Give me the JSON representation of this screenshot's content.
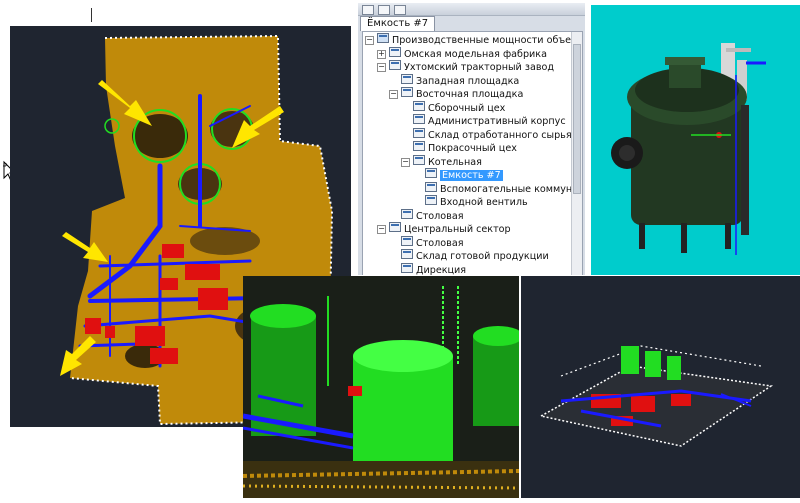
{
  "tree": {
    "tab_label": "Ёмкость #7",
    "items": [
      {
        "label": "Производственные мощности объедин",
        "depth": 0,
        "expander": "−",
        "root": true
      },
      {
        "label": "Омская модельная фабрика",
        "depth": 1,
        "expander": "+"
      },
      {
        "label": "Ухтомский тракторный завод",
        "depth": 1,
        "expander": "−"
      },
      {
        "label": "Западная площадка",
        "depth": 2,
        "expander": ""
      },
      {
        "label": "Восточная площадка",
        "depth": 2,
        "expander": "−"
      },
      {
        "label": "Сборочный цех",
        "depth": 3,
        "expander": ""
      },
      {
        "label": "Административный корпус",
        "depth": 3,
        "expander": ""
      },
      {
        "label": "Склад отработанного сырья",
        "depth": 3,
        "expander": ""
      },
      {
        "label": "Покрасочный цех",
        "depth": 3,
        "expander": ""
      },
      {
        "label": "Котельная",
        "depth": 3,
        "expander": "−"
      },
      {
        "label": "Ёмкость #7",
        "depth": 4,
        "expander": "",
        "selected": true
      },
      {
        "label": "Вспомогательные коммун",
        "depth": 4,
        "expander": ""
      },
      {
        "label": "Входной вентиль",
        "depth": 4,
        "expander": ""
      },
      {
        "label": "Столовая",
        "depth": 2,
        "expander": ""
      },
      {
        "label": "Центральный сектор",
        "depth": 1,
        "expander": "−"
      },
      {
        "label": "Столовая",
        "depth": 2,
        "expander": ""
      },
      {
        "label": "Склад готовой продукции",
        "depth": 2,
        "expander": ""
      },
      {
        "label": "Дирекция",
        "depth": 2,
        "expander": ""
      }
    ]
  },
  "colors": {
    "scan_background": "#1f2530",
    "point_cloud_ground": "#c08a0a",
    "piping": "#1a1aff",
    "equipment": "#e01010",
    "tank": "#22dd22",
    "tank_view_background": "#00cccc",
    "arrow": "#ffe600"
  },
  "icons": [
    "cursor-move-icon",
    "node-icon",
    "expand-icon",
    "collapse-icon"
  ]
}
